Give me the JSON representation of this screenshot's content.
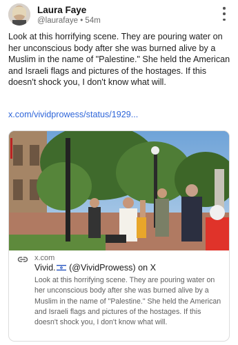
{
  "post": {
    "author_name": "Laura Faye",
    "handle": "@laurafaye",
    "separator": "•",
    "time": "54m",
    "text": "Look at this horrifying scene. They are pouring water on her unconscious body after she was burned alive by a Muslim in the name of \"Palestine.\" She held the American and Israeli flags and pictures of the hostages. If this doesn't shock you, I don't know what will.",
    "link": "x.com/vividprowess/status/1929..."
  },
  "icons": {
    "menu": "kebab-vertical-icon",
    "link": "link-icon",
    "flag": "israel-flag-icon"
  },
  "card": {
    "domain": "x.com",
    "title_before": "Vivid.",
    "title_after": " (@VividProwess) on X",
    "description": "Look at this horrifying scene. They are pouring water on her unconscious body after she was burned alive by a Muslim in the name of \"Palestine.\" She held the American and Israeli flags and pictures of the hostages. If this doesn't shock you, I don't know what will."
  },
  "colors": {
    "link": "#2f66d9",
    "muted": "#6b6b6b",
    "border": "#dcdcdc"
  }
}
